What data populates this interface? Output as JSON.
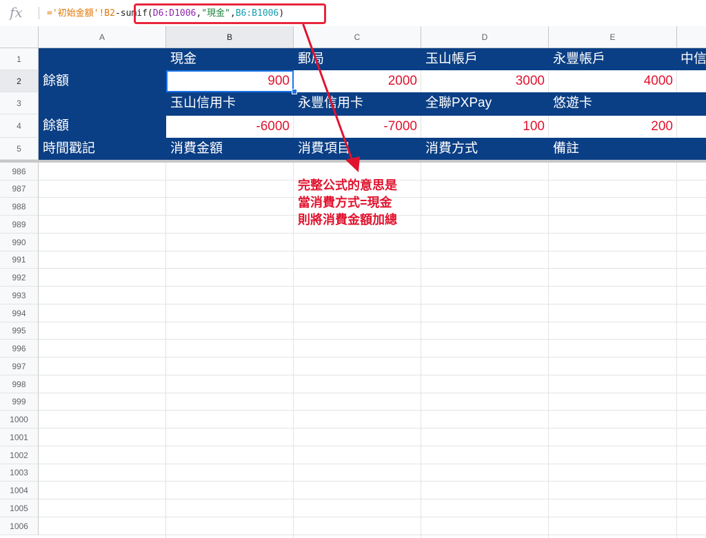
{
  "formula_bar": {
    "fx": "fx",
    "tokens": [
      "='初始金額'!B2",
      "-",
      "sumif(",
      "D6:D1006",
      ",",
      "\"現金\"",
      ",",
      "B6:B1006",
      ")"
    ]
  },
  "columns": [
    "A",
    "B",
    "C",
    "D",
    "E"
  ],
  "top_rows": [
    "1",
    "2",
    "3",
    "4",
    "5"
  ],
  "rows": {
    "r1": {
      "a": "",
      "b": "現金",
      "c": "郵局",
      "d": "玉山帳戶",
      "e": "永豐帳戶",
      "f": "中信"
    },
    "r2": {
      "a": "餘額",
      "b": "900",
      "c": "2000",
      "d": "3000",
      "e": "4000"
    },
    "r3": {
      "b": "玉山信用卡",
      "c": "永豐信用卡",
      "d": "全聯PXPay",
      "e": "悠遊卡"
    },
    "r4": {
      "a": "餘額",
      "b": "-6000",
      "c": "-7000",
      "d": "100",
      "e": "200"
    },
    "r5": {
      "a": "時間戳記",
      "b": "消費金額",
      "c": "消費項目",
      "d": "消費方式",
      "e": "備註"
    }
  },
  "lower_rows": [
    "986",
    "987",
    "988",
    "989",
    "990",
    "991",
    "992",
    "993",
    "994",
    "995",
    "996",
    "997",
    "998",
    "999",
    "1000",
    "1001",
    "1002",
    "1003",
    "1004",
    "1005",
    "1006"
  ],
  "annotation": {
    "lines": [
      "完整公式的意思是",
      "當消費方式=現金",
      "則將消費金額加總"
    ]
  },
  "colors": {
    "header_band": "#0b3f85",
    "negative_and_values": "#e0132e",
    "annotation": "#e0132e",
    "selection": "#1a73e8"
  }
}
